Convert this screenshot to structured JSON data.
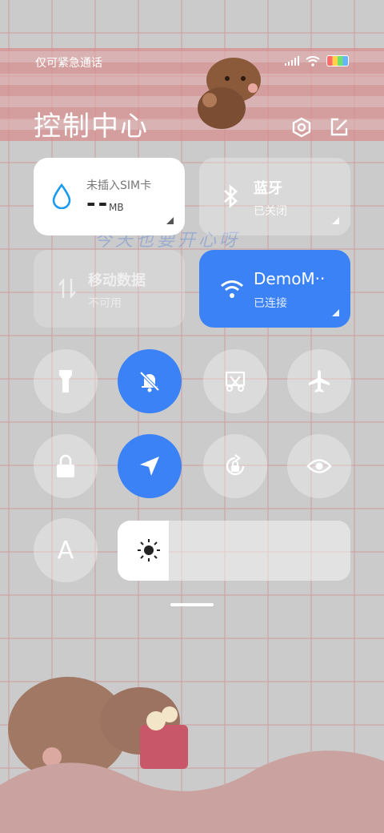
{
  "status_bar": {
    "carrier": "仅可紧急通话",
    "icons": [
      "signal-icon",
      "wifi-icon",
      "battery-icon"
    ]
  },
  "header": {
    "title": "控制中心",
    "icons": [
      "settings-icon",
      "edit-icon"
    ]
  },
  "tiles": {
    "data": {
      "title": "未插入SIM卡",
      "value": "--",
      "unit": "MB",
      "icon": "water-drop-icon"
    },
    "bluetooth": {
      "title": "蓝牙",
      "status": "已关闭",
      "icon": "bluetooth-icon"
    },
    "mobile_data": {
      "title": "移动数据",
      "status": "不可用",
      "icon": "mobile-data-icon"
    },
    "wifi": {
      "title": "DemoM··",
      "status": "已连接",
      "icon": "wifi-icon"
    }
  },
  "toggles": [
    {
      "name": "flashlight-icon",
      "active": false
    },
    {
      "name": "mute-bell-icon",
      "active": true
    },
    {
      "name": "screenshot-icon",
      "active": false
    },
    {
      "name": "airplane-icon",
      "active": false
    },
    {
      "name": "lock-icon",
      "active": false
    },
    {
      "name": "location-icon",
      "active": true
    },
    {
      "name": "rotation-lock-icon",
      "active": false
    },
    {
      "name": "eye-icon",
      "active": false
    },
    {
      "name": "font-size-icon",
      "active": false
    }
  ],
  "font_toggle_label": "A",
  "brightness": {
    "level": 0.22,
    "icon": "sun-icon"
  },
  "wallpaper_text": "今天也要开心呀",
  "colors": {
    "accent": "#3b82f6",
    "tile_white": "#ffffff",
    "band": "#d98f8f"
  }
}
